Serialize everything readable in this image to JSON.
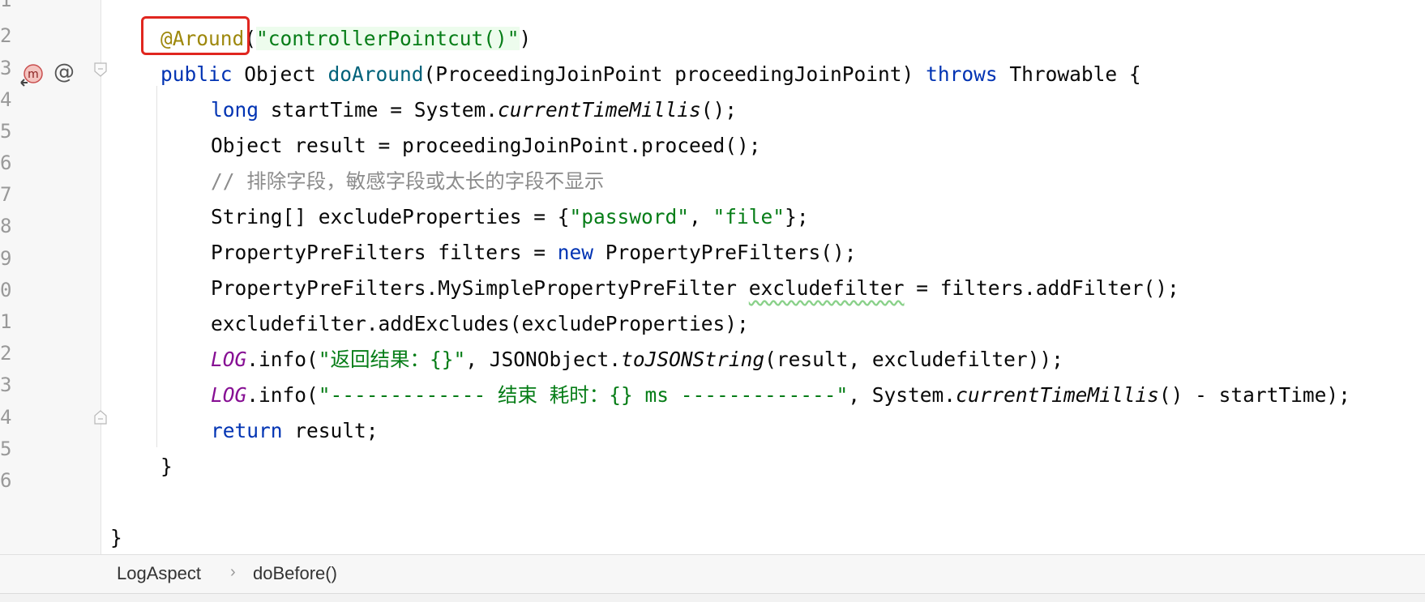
{
  "gutter": {
    "line_numbers": [
      "1",
      "2",
      "3",
      "4",
      "5",
      "6",
      "7",
      "8",
      "9",
      "0",
      "1",
      "2",
      "3",
      "4",
      "5",
      "6"
    ]
  },
  "code": {
    "line2": {
      "annotation": "@Around",
      "paren_open": "(",
      "string": "\"controllerPointcut()\"",
      "paren_close": ")"
    },
    "line3": {
      "kw_public": "public",
      "type": " Object ",
      "method": "doAround",
      "params": "(ProceedingJoinPoint proceedingJoinPoint) ",
      "kw_throws": "throws",
      "rest": " Throwable {"
    },
    "line4": {
      "kw_long": "long",
      "a": " startTime = System.",
      "call": "currentTimeMillis",
      "b": "();"
    },
    "line5": {
      "text": "Object result = proceedingJoinPoint.proceed();"
    },
    "line6": {
      "comment": "// 排除字段，敏感字段或太长的字段不显示"
    },
    "line7": {
      "a": "String[] excludeProperties = {",
      "s1": "\"password\"",
      "comma": ", ",
      "s2": "\"file\"",
      "b": "};"
    },
    "line8": {
      "a": "PropertyPreFilters filters = ",
      "kw_new": "new",
      "b": " PropertyPreFilters();"
    },
    "line9": {
      "a": "PropertyPreFilters.MySimplePropertyPreFilter ",
      "warn": "excludefilter",
      "b": " = filters.addFilter();"
    },
    "line10": {
      "text": "excludefilter.addExcludes(excludeProperties);"
    },
    "line11": {
      "log": "LOG",
      "a": ".info(",
      "str": "\"返回结果：{}\"",
      "b": ", JSONObject.",
      "call": "toJSONString",
      "c": "(result, excludefilter));"
    },
    "line12": {
      "log": "LOG",
      "a": ".info(",
      "str": "\"------------- 结束 耗时：{} ms -------------\"",
      "b": ", System.",
      "call": "currentTimeMillis",
      "c": "() - startTime);"
    },
    "line13": {
      "kw_return": "return",
      "a": " result;"
    },
    "line14": {
      "text": "}"
    },
    "line16": {
      "text": "}"
    }
  },
  "icons": {
    "method_icon": "method-implements-icon",
    "at_icon": "@"
  },
  "breadcrumb": {
    "class_name": "LogAspect",
    "separator": "›",
    "method_name": "doBefore()"
  },
  "colors": {
    "keyword": "#0033b3",
    "annotation": "#9e880d",
    "string": "#067d17",
    "comment": "#8c8c8c",
    "static_field": "#871094",
    "highlight_box": "#e0261f"
  }
}
